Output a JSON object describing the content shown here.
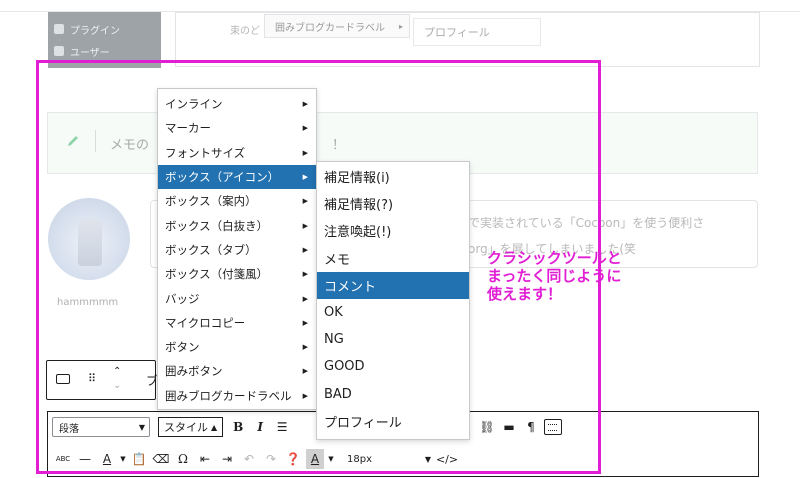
{
  "wp_sidebar": {
    "items": [
      {
        "label": "プラグイン",
        "icon": "plugin-icon"
      },
      {
        "label": "ユーザー",
        "icon": "user-icon"
      }
    ]
  },
  "background": {
    "card_text": "束のど",
    "tooltip_label": "囲みブログカードラベル",
    "tooltip_submenu_label": "プロフィール",
    "memo_prefix": "メモの",
    "memo_suffix": "！",
    "avatar_name": "hammmmm",
    "bubble_line1": "で実装されている「Cocoon」を使う便利さ",
    "bubble_line2": "org」を展してしまいました(笑"
  },
  "block_toolbar": {
    "up_glyph": "⌃",
    "down_glyph": "⌄",
    "next_glyph": "ブ"
  },
  "classic_toolbar": {
    "format_select": "段落",
    "style_button": "スタイル",
    "font_size": "18px",
    "accent": "#2271b1"
  },
  "menu": {
    "items": [
      {
        "label": "インライン"
      },
      {
        "label": "マーカー"
      },
      {
        "label": "フォントサイズ"
      },
      {
        "label": "ボックス（アイコン）",
        "active": true
      },
      {
        "label": "ボックス（案内）"
      },
      {
        "label": "ボックス（白抜き）"
      },
      {
        "label": "ボックス（タブ）"
      },
      {
        "label": "ボックス（付箋風）"
      },
      {
        "label": "バッジ"
      },
      {
        "label": "マイクロコピー"
      },
      {
        "label": "ボタン"
      },
      {
        "label": "囲みボタン"
      },
      {
        "label": "囲みブログカードラベル"
      }
    ]
  },
  "submenu": {
    "items": [
      {
        "label": "補足情報(i)"
      },
      {
        "label": "補足情報(?)"
      },
      {
        "label": "注意喚起(!)"
      },
      {
        "label": "メモ"
      },
      {
        "label": "コメント",
        "active": true
      },
      {
        "label": "OK"
      },
      {
        "label": "NG"
      },
      {
        "label": "GOOD"
      },
      {
        "label": "BAD"
      },
      {
        "label": "プロフィール"
      }
    ]
  },
  "annotation": {
    "text": "クラシックツールと\nまったく同じように\n使えます！",
    "color": "#e21ed5"
  }
}
